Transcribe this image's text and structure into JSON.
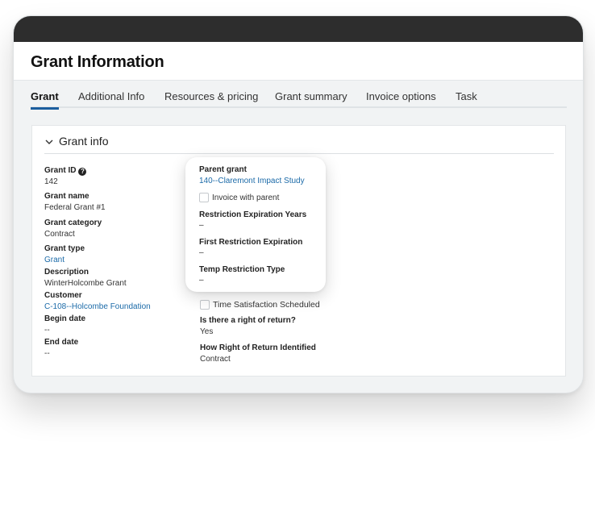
{
  "page": {
    "title": "Grant Information"
  },
  "tabs": [
    {
      "label": "Grant",
      "active": true
    },
    {
      "label": "Additional Info"
    },
    {
      "label": "Resources & pricing"
    },
    {
      "label": "Grant summary"
    },
    {
      "label": "Invoice options"
    },
    {
      "label": "Task"
    }
  ],
  "section": {
    "title": "Grant info",
    "expanded": true,
    "chevron_icon": "chevron-down-icon"
  },
  "left_fields": {
    "grant_id": {
      "label": "Grant ID",
      "value": "142",
      "help_icon": "?"
    },
    "grant_name": {
      "label": "Grant name",
      "value": "Federal Grant #1"
    },
    "grant_category": {
      "label": "Grant category",
      "value": "Contract"
    },
    "grant_type": {
      "label": "Grant type",
      "value": "Grant"
    },
    "description": {
      "label": "Description",
      "value": "WinterHolcombe Grant"
    },
    "customer": {
      "label": "Customer",
      "value": "C-108--Holcombe Foundation"
    },
    "begin_date": {
      "label": "Begin date",
      "value": "--"
    },
    "end_date": {
      "label": "End date",
      "value": "--"
    }
  },
  "popover": {
    "parent_grant": {
      "label": "Parent grant",
      "value": "140--Claremont Impact Study"
    },
    "invoice_with_parent": {
      "label": "Invoice with parent",
      "checked": false
    },
    "restriction_expiration_years": {
      "label": "Restriction Expiration Years",
      "value": "–"
    },
    "first_restriction_expiration": {
      "label": "First Restriction Expiration",
      "value": "–"
    },
    "temp_restriction_type": {
      "label": "Temp Restriction Type",
      "value": "–"
    }
  },
  "right_fields": {
    "time_satisfaction_scheduled": {
      "label": "Time Satisfaction Scheduled",
      "checked": false
    },
    "right_of_return": {
      "label": "Is there a right of return?",
      "value": "Yes"
    },
    "how_right_of_return_identified": {
      "label": "How Right of Return Identified",
      "value": "Contract"
    }
  },
  "colors": {
    "accent": "#1b5e9e",
    "link": "#1b6aa8",
    "titlebar": "#2d2d2d",
    "background": "#f1f3f4"
  }
}
